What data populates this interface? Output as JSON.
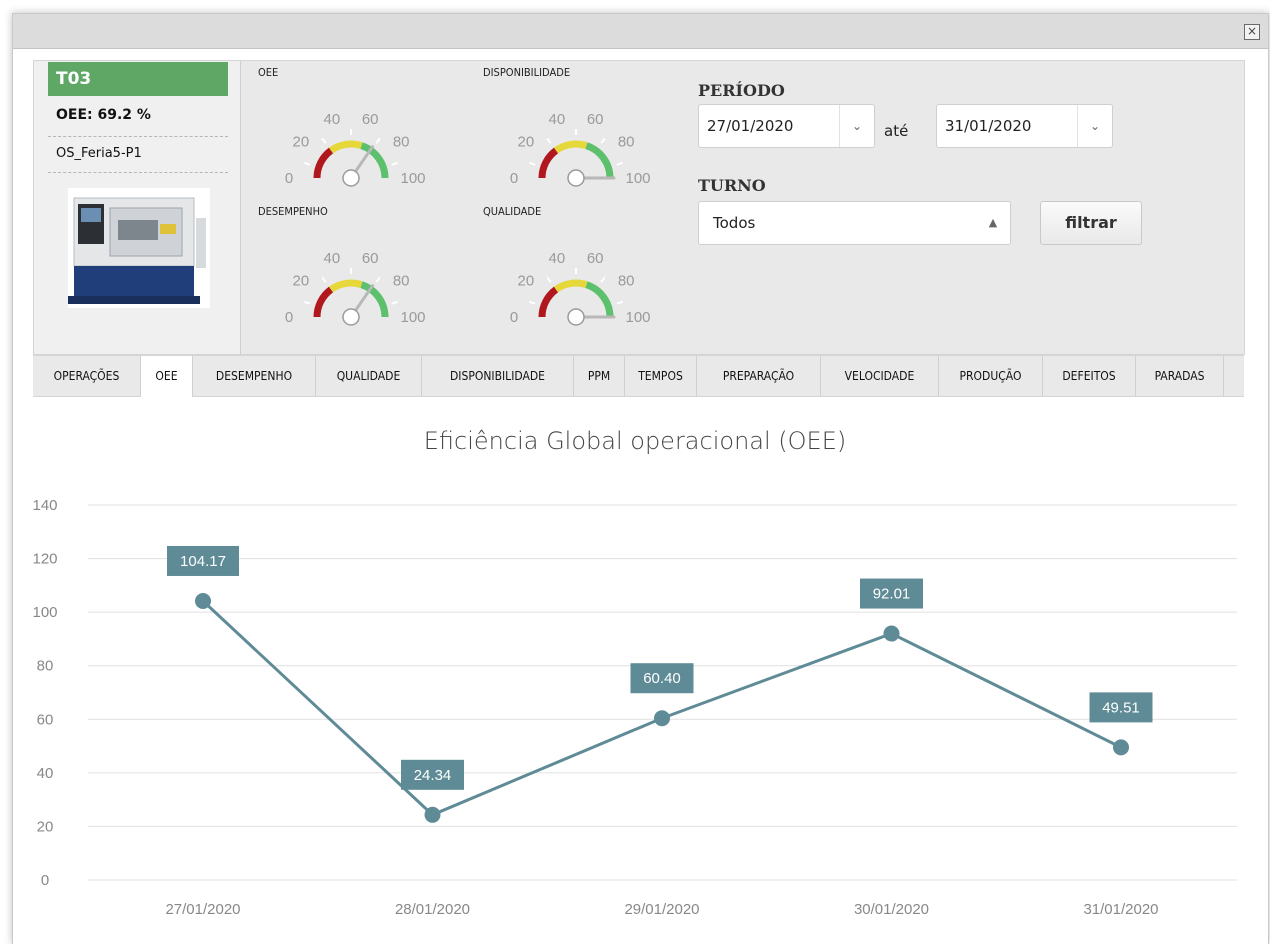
{
  "window": {
    "close_label": "×"
  },
  "machine": {
    "id": "T03",
    "oee": "OEE: 69.2 %",
    "os": "OS_Feria5-P1",
    "header_color": "#5fa764"
  },
  "gauges": [
    {
      "title": "OEE",
      "value": 69.2
    },
    {
      "title": "DISPONIBILIDADE",
      "value": 100
    },
    {
      "title": "DESEMPENHO",
      "value": 69.2
    },
    {
      "title": "QUALIDADE",
      "value": 100
    }
  ],
  "gauge_ticks": [
    "0",
    "20",
    "40",
    "60",
    "80",
    "100"
  ],
  "filters": {
    "period_label": "PERÍODO",
    "start_date": "27/01/2020",
    "until_label": "até",
    "end_date": "31/01/2020",
    "shift_label": "TURNO",
    "shift_value": "Todos",
    "filter_button": "filtrar"
  },
  "tabs": [
    {
      "label": "OPERAÇÕES"
    },
    {
      "label": "OEE",
      "active": true
    },
    {
      "label": "DESEMPENHO"
    },
    {
      "label": "QUALIDADE"
    },
    {
      "label": "DISPONIBILIDADE"
    },
    {
      "label": "PPM"
    },
    {
      "label": "TEMPOS"
    },
    {
      "label": "PREPARAÇÃO"
    },
    {
      "label": "VELOCIDADE"
    },
    {
      "label": "PRODUÇÃO"
    },
    {
      "label": "DEFEITOS"
    },
    {
      "label": "PARADAS"
    }
  ],
  "chart_data": {
    "type": "line",
    "title": "Eficiência Global operacional (OEE)",
    "categories": [
      "27/01/2020",
      "28/01/2020",
      "29/01/2020",
      "30/01/2020",
      "31/01/2020"
    ],
    "series": [
      {
        "values": [
          104.17,
          24.34,
          60.4,
          92.01,
          49.51
        ],
        "color": "#5e8b96"
      }
    ],
    "data_labels": [
      "104.17",
      "24.34",
      "60.40",
      "92.01",
      "49.51"
    ],
    "ylim": [
      0,
      140
    ],
    "yticks": [
      0,
      20,
      40,
      60,
      80,
      100,
      120,
      140
    ],
    "grid": true,
    "legend": "none"
  }
}
